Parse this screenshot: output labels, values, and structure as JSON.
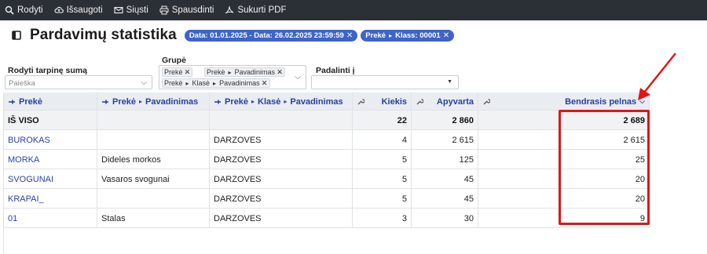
{
  "toolbar": {
    "buttons": [
      {
        "label": "Rodyti",
        "icon": "search-icon"
      },
      {
        "label": "Išsaugoti",
        "icon": "cloud-upload-icon"
      },
      {
        "label": "Siųsti",
        "icon": "mail-icon"
      },
      {
        "label": "Spausdinti",
        "icon": "printer-icon"
      },
      {
        "label": "Sukurti PDF",
        "icon": "pdf-icon"
      }
    ]
  },
  "page": {
    "title": "Pardavimų statistika",
    "chips": [
      {
        "label": "Data: 01.01.2025 - Data: 26.02.2025 23:59:59"
      },
      {
        "label_a": "Prekė",
        "label_b": "Klass: 00001"
      }
    ]
  },
  "filters": {
    "subtotal": {
      "label": "Rodyti tarpinę sumą",
      "placeholder": "Paieška"
    },
    "group": {
      "label": "Grupė",
      "tags": [
        {
          "parts": [
            "Prekė"
          ]
        },
        {
          "parts": [
            "Prekė",
            "Pavadinimas"
          ]
        },
        {
          "parts": [
            "Prekė",
            "Klasė",
            "Pavadinimas"
          ]
        }
      ]
    },
    "split": {
      "label": "Padalinti į"
    }
  },
  "table": {
    "headers": {
      "item": "Prekė",
      "item_name": [
        "Prekė",
        "Pavadinimas"
      ],
      "item_class_name": [
        "Prekė",
        "Klasė",
        "Pavadinimas"
      ],
      "qty": "Kiekis",
      "turnover": "Apyvarta",
      "profit": "Bendrasis pelnas"
    },
    "total": {
      "label": "IŠ VISO",
      "qty": "22",
      "turnover": "2 860",
      "profit": "2 689"
    },
    "rows": [
      {
        "item": "BUROKAS",
        "name": "",
        "class_name": "DARZOVES",
        "qty": "4",
        "turnover": "2 615",
        "profit": "2 615"
      },
      {
        "item": "MORKA",
        "name": "Dideles morkos",
        "class_name": "DARZOVES",
        "qty": "5",
        "turnover": "125",
        "profit": "25"
      },
      {
        "item": "SVOGUNAI",
        "name": "Vasaros svogunai",
        "class_name": "DARZOVES",
        "qty": "5",
        "turnover": "45",
        "profit": "20"
      },
      {
        "item": "KRAPAI_",
        "name": "",
        "class_name": "DARZOVES",
        "qty": "5",
        "turnover": "45",
        "profit": "20"
      },
      {
        "item": "01",
        "name": "Stalas",
        "class_name": "DARZOVES",
        "qty": "3",
        "turnover": "30",
        "profit": "9"
      }
    ]
  },
  "colors": {
    "toolbar_bg": "#2b2f36",
    "chip_bg": "#3f63c9",
    "header_bg": "#e9ecf1",
    "header_text": "#2a3f9a",
    "link": "#2a41b8",
    "highlight": "#e21515"
  }
}
